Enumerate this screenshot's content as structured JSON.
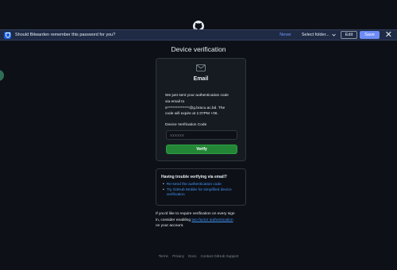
{
  "bitwarden": {
    "message": "Should Bitwarden remember this password for you?",
    "never_label": "Never",
    "folder_select": "Select folder...",
    "edit_label": "Edit",
    "save_label": "Save",
    "close_glyph": "✕",
    "brand_color": "#175ddc"
  },
  "page": {
    "title": "Device verification"
  },
  "card": {
    "icon": "mail-icon",
    "heading": "Email",
    "line1": "We just sent your authentication code",
    "line2": "via email to",
    "line3": "s***************@g.bracu.ac.bd. The",
    "line4": "code will expire at 1:07PM +06.",
    "field_label": "Device Verification Code",
    "input_placeholder": "XXXXXX",
    "verify_label": "Verify",
    "verify_color": "#238636"
  },
  "help": {
    "title": "Having trouble verifying via email?",
    "items": [
      "Re-send the authentication code",
      "Try GitHub Mobile for simplified device",
      "verification"
    ]
  },
  "note": {
    "line1": "If you'd like to require verification on every sign",
    "line2_prefix": "in, consider enabling ",
    "line2_link": "two-factor authentication",
    "line3": "on your account."
  },
  "footer": {
    "links": [
      "Terms",
      "Privacy",
      "Docs",
      "Contact GitHub Support"
    ]
  }
}
